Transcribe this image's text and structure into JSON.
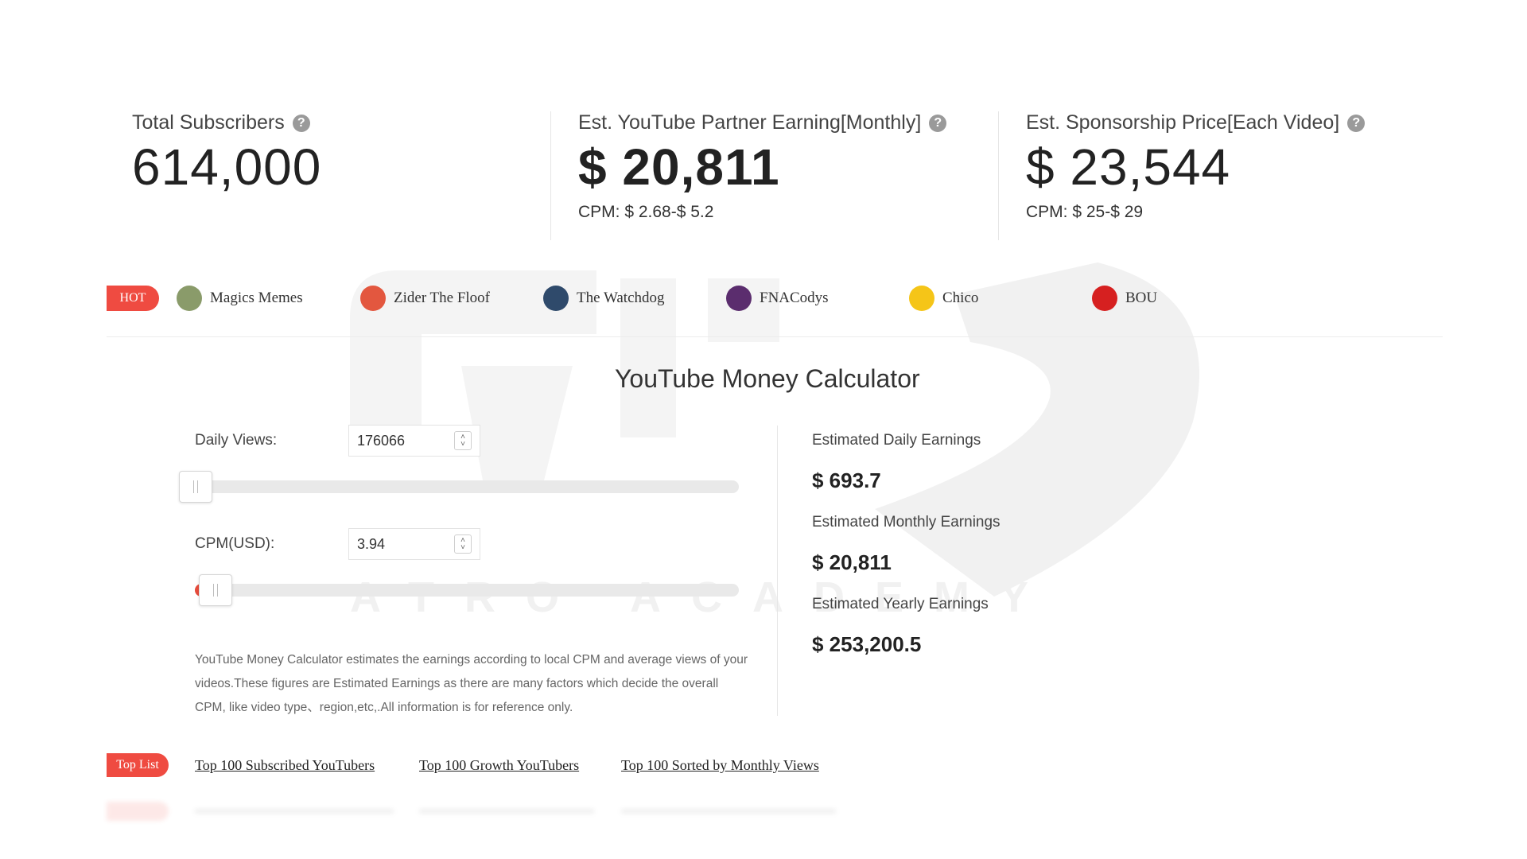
{
  "stats": {
    "subscribers": {
      "label": "Total Subscribers",
      "value": "614,000"
    },
    "partner": {
      "label": "Est. YouTube Partner Earning[Monthly]",
      "value": "$ 20,811",
      "cpm": "CPM: $ 2.68-$ 5.2"
    },
    "sponsorship": {
      "label": "Est. Sponsorship Price[Each Video]",
      "value": "$ 23,544",
      "cpm": "CPM: $ 25-$ 29"
    },
    "help_icon": "?"
  },
  "hot": {
    "badge": "HOT",
    "channels": [
      {
        "name": "Magics Memes",
        "color": "#8a9b6a"
      },
      {
        "name": "Zider The Floof",
        "color": "#e3573f"
      },
      {
        "name": "The Watchdog",
        "color": "#2f4a6b"
      },
      {
        "name": "FNACodys",
        "color": "#5b2d6e"
      },
      {
        "name": "Chico",
        "color": "#f5c518"
      },
      {
        "name": "BOU",
        "color": "#d62020"
      }
    ]
  },
  "calculator": {
    "title": "YouTube Money Calculator",
    "daily_views": {
      "label": "Daily Views:",
      "value": "176066"
    },
    "cpm": {
      "label": "CPM(USD):",
      "value": "3.94"
    },
    "description": "YouTube Money Calculator estimates the earnings according to local CPM and average views of your videos.These figures are Estimated Earnings as there are many factors which decide the overall CPM, like video type、region,etc,.All information is for reference only.",
    "results": {
      "daily": {
        "label": "Estimated Daily Earnings",
        "value": "$ 693.7"
      },
      "monthly": {
        "label": "Estimated Monthly Earnings",
        "value": "$ 20,811"
      },
      "yearly": {
        "label": "Estimated Yearly Earnings",
        "value": "$ 253,200.5"
      }
    }
  },
  "top_list": {
    "badge": "Top List",
    "links": [
      "Top 100 Subscribed YouTubers",
      "Top 100 Growth YouTubers",
      "Top 100 Sorted by Monthly Views"
    ]
  },
  "watermark": {
    "text": "ATRO ACADEMY"
  }
}
